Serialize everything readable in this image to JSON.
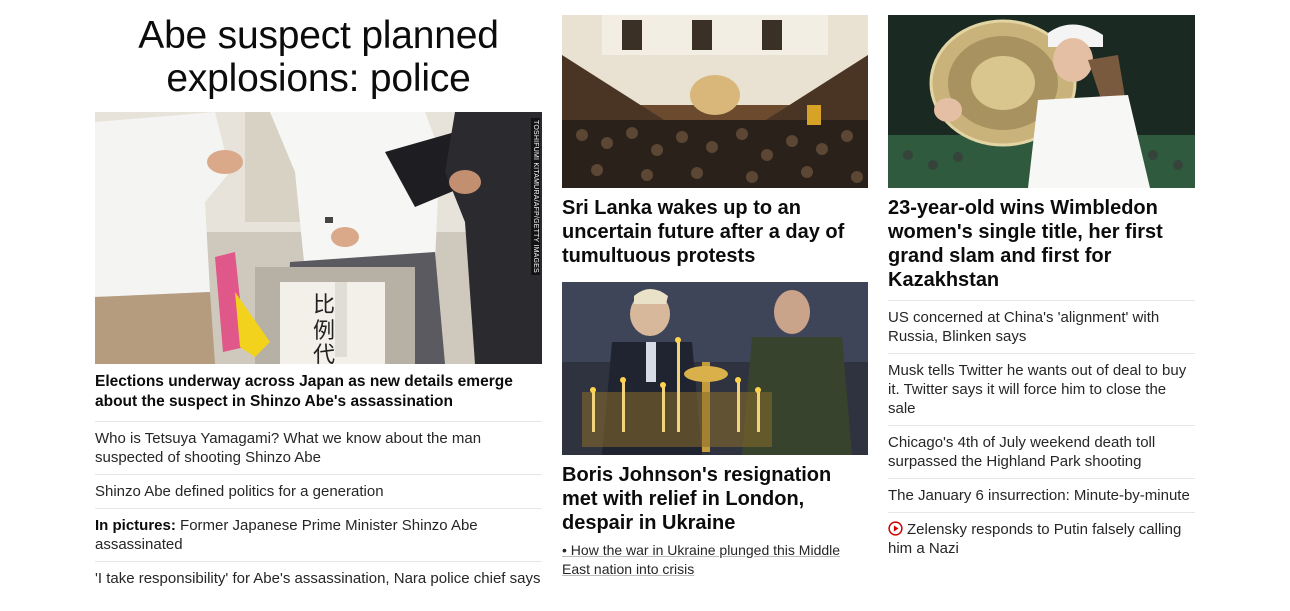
{
  "col1": {
    "headline": "Abe suspect planned explosions: police",
    "photo_credit": "TOSHIFUMI KITAMURA/AFP/GETTY IMAGES",
    "lead_title": "Elections underway across Japan as new details emerge about the suspect in Shinzo Abe's assassination",
    "items": [
      {
        "text": "Who is Tetsuya Yamagami? What we know about the man suspected of shooting Shinzo Abe"
      },
      {
        "text": "Shinzo Abe defined politics for a generation"
      },
      {
        "prefix": "In pictures:",
        "text": " Former Japanese Prime Minister Shinzo Abe assassinated"
      },
      {
        "text": "'I take responsibility' for Abe's assassination, Nara police chief says"
      }
    ]
  },
  "col2": {
    "story1_title": "Sri Lanka wakes up to an uncertain future after a day of tumultuous protests",
    "story2_title": "Boris Johnson's resignation met with relief in London, despair in Ukraine",
    "story2_link": "• How the war in Ukraine plunged this Middle East nation into crisis"
  },
  "col3": {
    "story_title": "23-year-old wins Wimbledon women's single title, her first grand slam and first for Kazakhstan",
    "items": [
      {
        "text": "US concerned at China's 'alignment' with Russia, Blinken says"
      },
      {
        "text": "Musk tells Twitter he wants out of deal to buy it. Twitter says it will force him to close the sale"
      },
      {
        "text": "Chicago's 4th of July weekend death toll surpassed the Highland Park shooting"
      },
      {
        "text": "The January 6 insurrection: Minute-by-minute"
      },
      {
        "text": "Zelensky responds to Putin falsely calling him a Nazi",
        "icon": "play-circle-icon"
      }
    ]
  },
  "colors": {
    "text": "#0c0c0c",
    "divider": "#e6e6e6",
    "video_red": "#cc0000"
  }
}
